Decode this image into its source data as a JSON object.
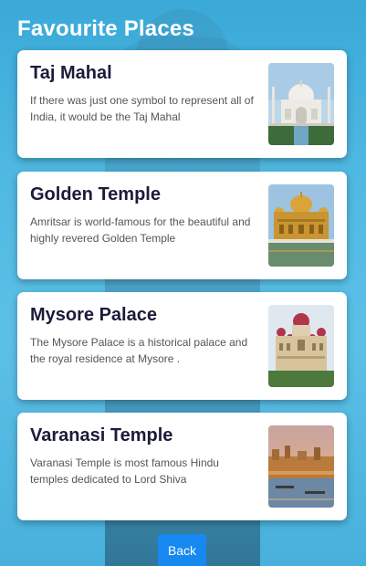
{
  "page": {
    "title": "Favourite Places"
  },
  "places": [
    {
      "name": "Taj Mahal",
      "description": "If there was just one symbol to represent all of India, it would be the Taj Mahal"
    },
    {
      "name": "Golden Temple",
      "description": "Amritsar is world-famous for the beautiful and highly revered Golden Temple"
    },
    {
      "name": "Mysore Palace",
      "description": "The Mysore Palace is a historical palace and the royal residence at Mysore ."
    },
    {
      "name": "Varanasi Temple",
      "description": "Varanasi Temple is most famous Hindu temples dedicated to Lord Shiva"
    }
  ],
  "footer": {
    "back_label": "Back"
  },
  "colors": {
    "accent": "#1788f0",
    "title": "#ffffff",
    "heading": "#1b1b3a",
    "body_text": "#555555"
  }
}
